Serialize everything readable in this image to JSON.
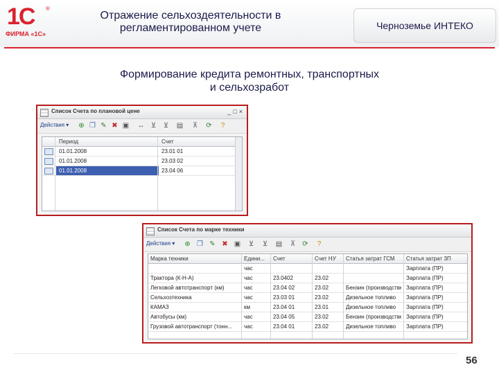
{
  "header": {
    "logo_text": "1С",
    "logo_reg": "®",
    "logo_firm": "ФИРМА «1С»",
    "title_line1": "Отражение сельхоздеятельности в",
    "title_line2": "регламентированном учете",
    "right_label": "Черноземье ИНТЕКО"
  },
  "slide": {
    "title_line1": "Формирование кредита ремонтных, транспортных",
    "title_line2": "и сельхозработ"
  },
  "window1": {
    "title": "Список Счета по плановой цене",
    "actions_label": "Действия ▾",
    "columns": [
      "Период",
      "Счет"
    ],
    "rows": [
      {
        "period": "01.01.2008",
        "account": "23.01 01",
        "selected": false
      },
      {
        "period": "01.01.2008",
        "account": "23.03 02",
        "selected": false
      },
      {
        "period": "01.01.2008",
        "account": "23.04 06",
        "selected": true
      }
    ]
  },
  "window2": {
    "title": "Список Счета по марке техники",
    "actions_label": "Действия ▾",
    "columns": [
      "Марка техники",
      "Едини...",
      "Счет",
      "Счет НУ",
      "Статья затрат ГСМ",
      "Статья затрат ЗП"
    ],
    "rows": [
      [
        "",
        "час",
        "",
        "",
        "",
        "Зарплата (ПР)"
      ],
      [
        "Трактора (К-Н-А)",
        "час",
        "23.0402",
        "23.02",
        "",
        "Зарплата (ПР)"
      ],
      [
        "Легковой автотранспорт (км)",
        "час",
        "23.04 02",
        "23.02",
        "Бензин (производствен...",
        "Зарплата (ПР)"
      ],
      [
        "Сельхозтехника",
        "час",
        "23.03 01",
        "23.02",
        "Дизельное топливо",
        "Зарплата (ПР)"
      ],
      [
        "КАМАЗ",
        "км",
        "23.04 01",
        "23.01",
        "Дизельное топливо",
        "Зарплата (ПР)"
      ],
      [
        "Автобусы (км)",
        "час",
        "23.04 05",
        "23.02",
        "Бензин (производствен...",
        "Зарплата (ПР)"
      ],
      [
        "Грузовой автотранспорт (тонн...",
        "час",
        "23.04 01",
        "23.02",
        "Дизельное топливо",
        "Зарплата (ПР)"
      ]
    ]
  },
  "page_number": "56",
  "colors": {
    "brand_red": "#d9232e",
    "title_text": "#1b1b4a",
    "selection": "#3d5fb0",
    "window_border": "#b71c1c"
  }
}
